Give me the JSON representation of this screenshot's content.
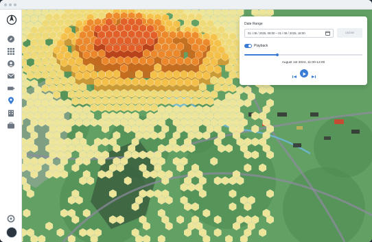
{
  "window": {
    "title_dots": [
      "red",
      "yellow",
      "green"
    ]
  },
  "sidebar": {
    "logo": "compass-logo-icon",
    "items": [
      {
        "icon": "compass-icon",
        "active": false
      },
      {
        "icon": "grid-icon",
        "active": false
      },
      {
        "icon": "user-icon",
        "active": false
      },
      {
        "icon": "mail-icon",
        "active": false
      },
      {
        "icon": "battery-icon",
        "active": false
      },
      {
        "icon": "map-pin-icon",
        "active": true
      },
      {
        "icon": "building-icon",
        "active": false
      },
      {
        "icon": "briefcase-icon",
        "active": false
      }
    ],
    "settings_icon": "gear-icon",
    "avatar_icon": "avatar"
  },
  "panel": {
    "title": "Date Range",
    "date_range_value": "01 / 08 / 2025, 09:00 – 01 / 08 / 2025, 18:00",
    "update_label": "Update",
    "playback_label": "Playback",
    "playback_enabled": true,
    "playback_progress": 0.28,
    "current_time": "August 1st 2024, 11:00-12:00"
  },
  "colors": {
    "accent": "#3a7bd5",
    "hex_light": "#f2e89c",
    "hex_mid": "#f6c24a",
    "hex_hot": "#ee8a2c",
    "hex_hottest": "#e4612a"
  }
}
